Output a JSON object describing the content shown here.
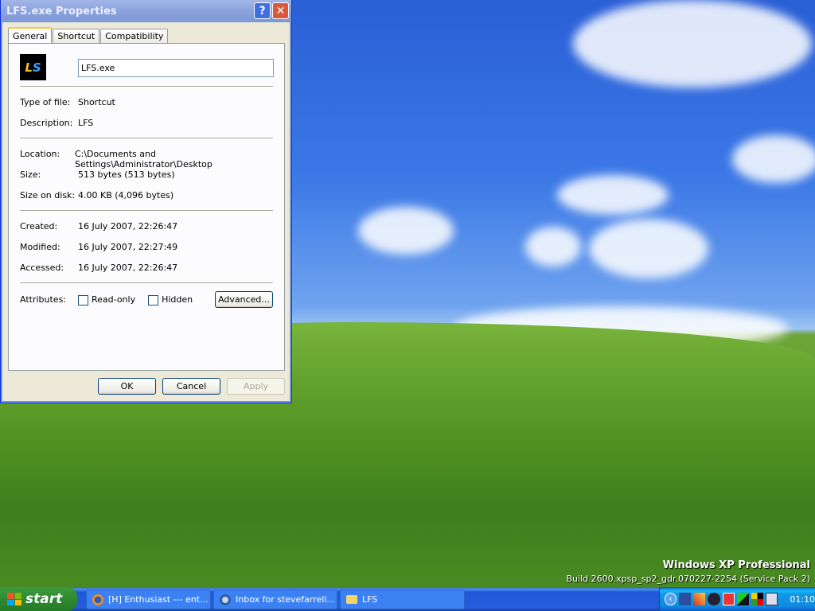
{
  "dialog": {
    "title": "LFS.exe Properties",
    "help_label": "?",
    "close_label": "✕",
    "tabs": [
      {
        "label": "General"
      },
      {
        "label": "Shortcut"
      },
      {
        "label": "Compatibility"
      }
    ],
    "file_name": "LFS.exe",
    "fields": {
      "type_label": "Type of file:",
      "type_value": "Shortcut",
      "desc_label": "Description:",
      "desc_value": "LFS",
      "loc_label": "Location:",
      "loc_value": "C:\\Documents and Settings\\Administrator\\Desktop",
      "size_label": "Size:",
      "size_value": "513 bytes (513 bytes)",
      "disk_label": "Size on disk:",
      "disk_value": "4.00 KB (4,096 bytes)",
      "created_label": "Created:",
      "created_value": "16 July 2007, 22:26:47",
      "modified_label": "Modified:",
      "modified_value": "16 July 2007, 22:27:49",
      "accessed_label": "Accessed:",
      "accessed_value": "16 July 2007, 22:26:47"
    },
    "attributes_label": "Attributes:",
    "readonly_label": "Read-only",
    "readonly_checked": false,
    "hidden_label": "Hidden",
    "hidden_checked": false,
    "advanced_label": "Advanced...",
    "ok_label": "OK",
    "cancel_label": "Cancel",
    "apply_label": "Apply"
  },
  "desktop": {
    "edition": "Windows XP Professional",
    "build": "Build 2600.xpsp_sp2_gdr.070227-2254 (Service Pack 2)"
  },
  "taskbar": {
    "start_label": "start",
    "tasks": [
      {
        "label": "[H] Enthusiast --- ent...",
        "icon": "firefox-icon"
      },
      {
        "label": "Inbox for stevefarrell...",
        "icon": "thunderbird-icon"
      },
      {
        "label": "LFS",
        "icon": "folder-icon"
      }
    ],
    "clock": "01:10"
  }
}
